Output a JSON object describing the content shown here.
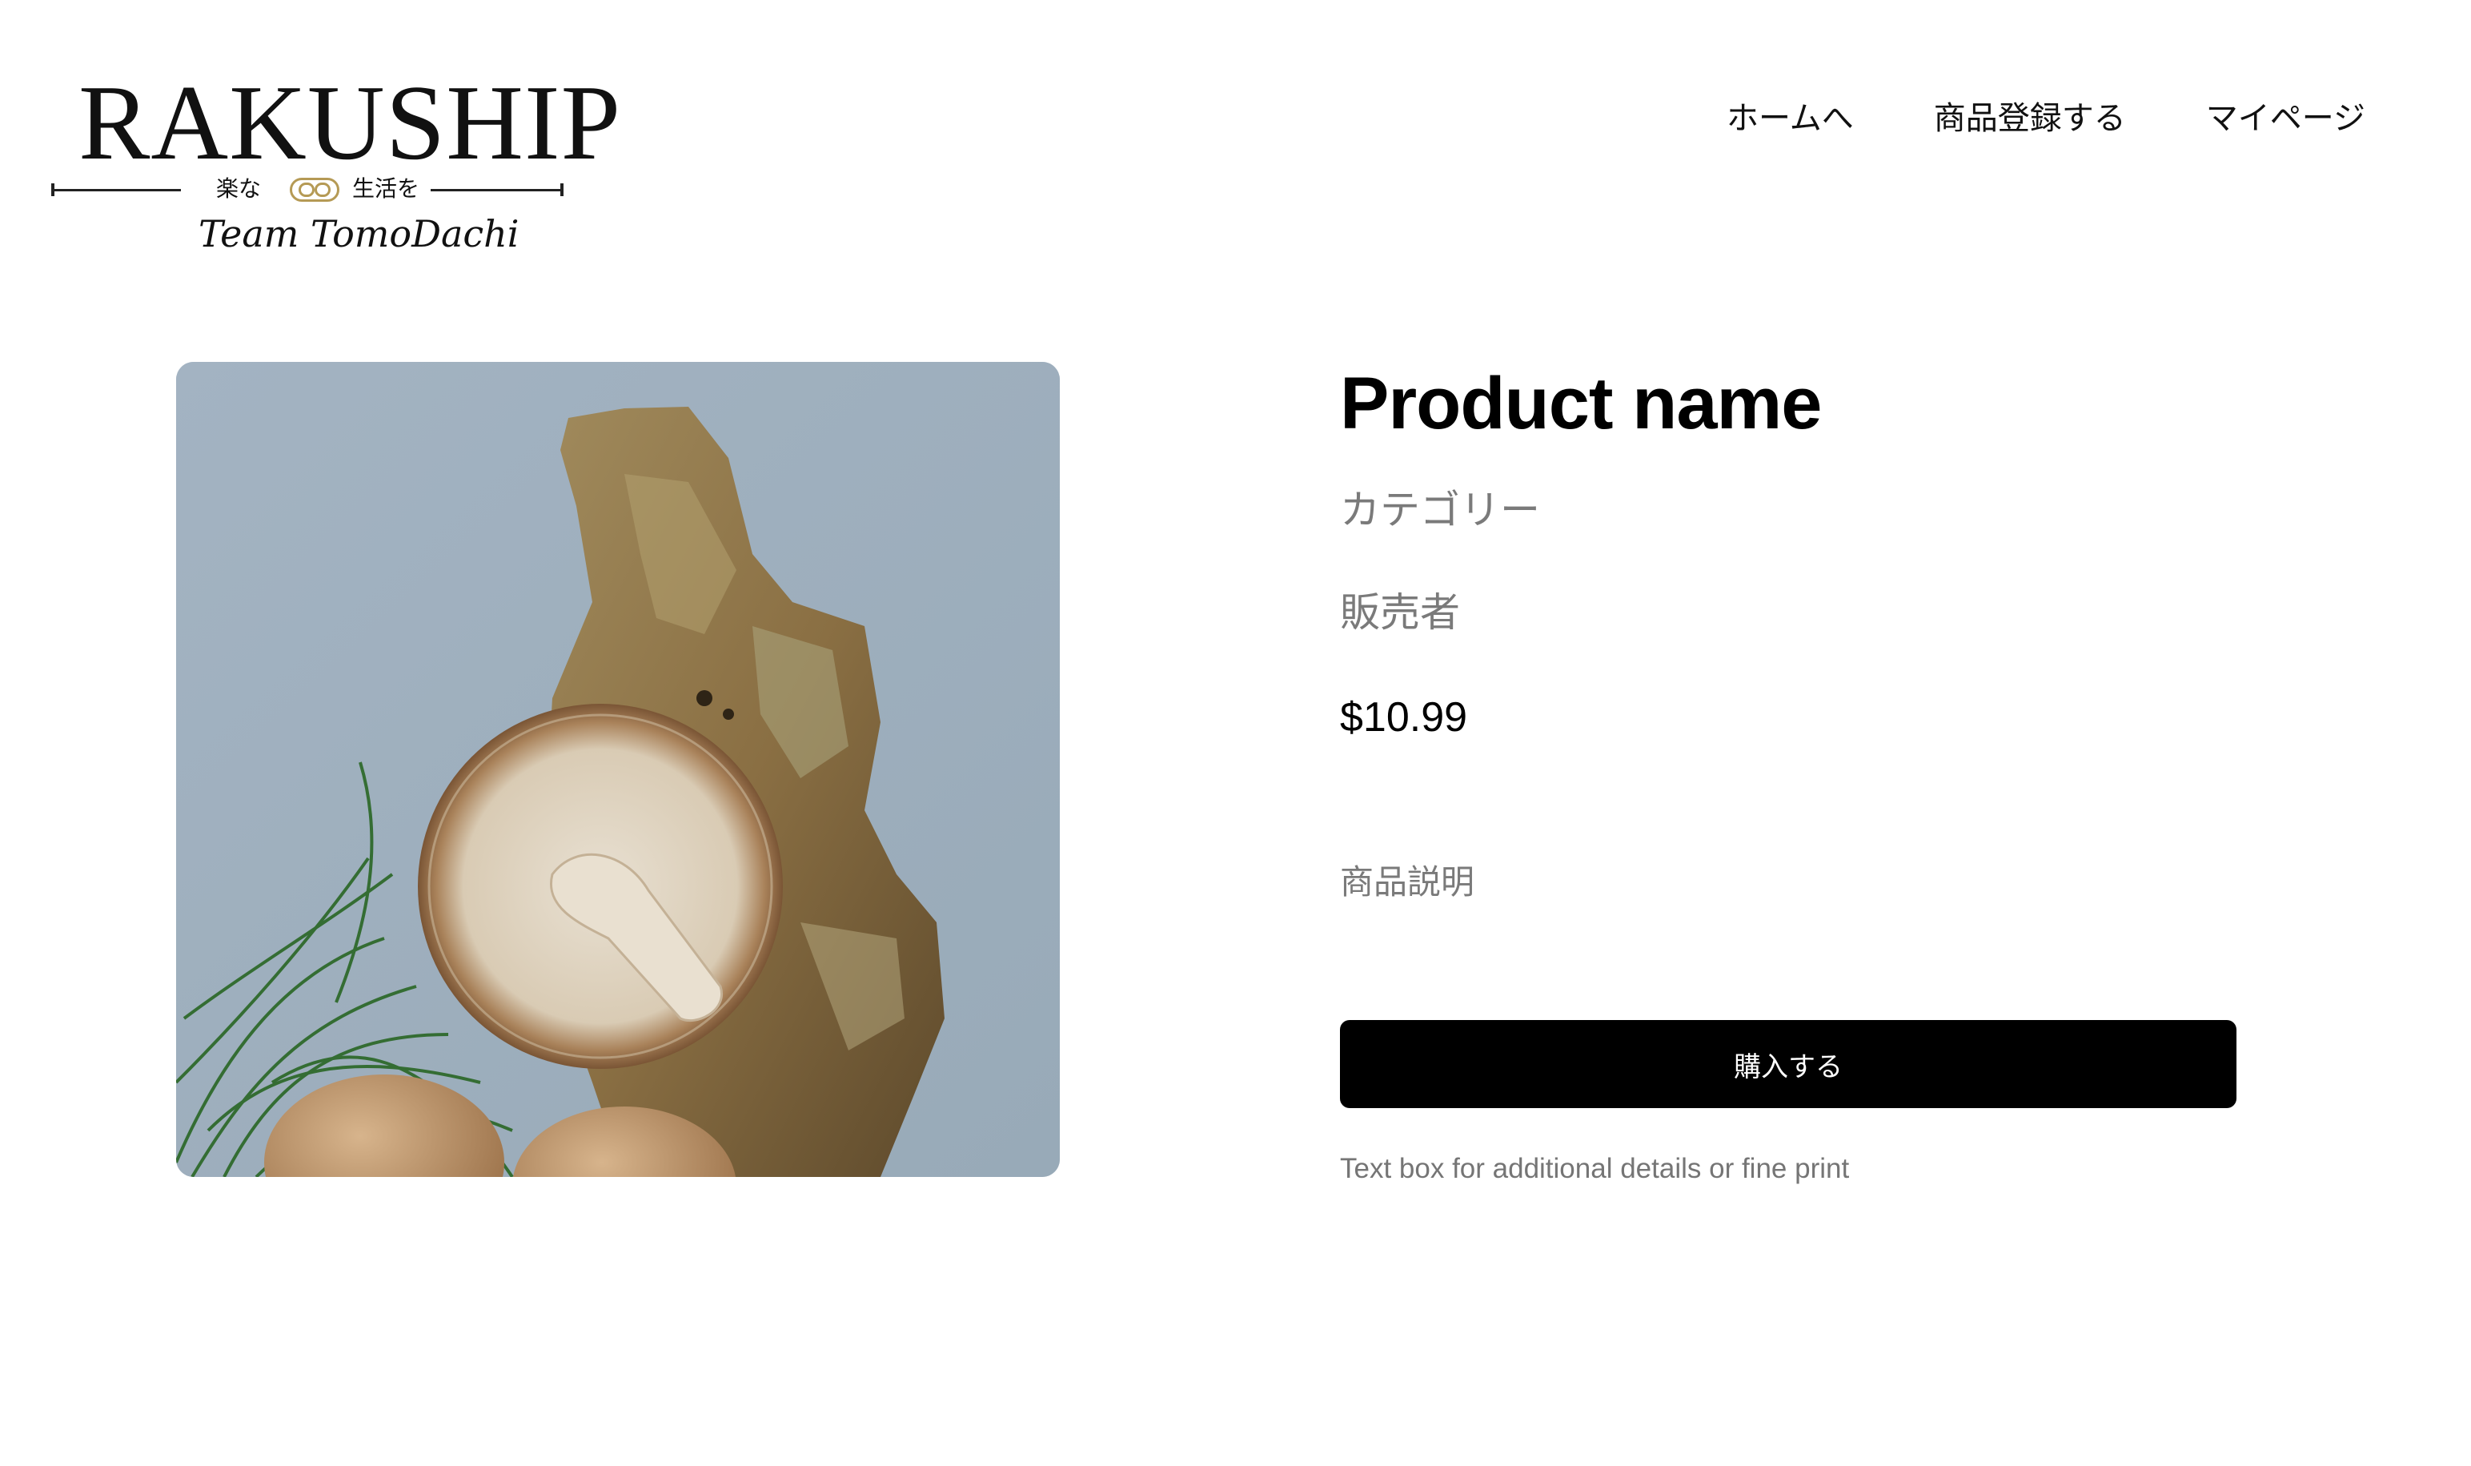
{
  "logo": {
    "wordmark": "RAKUSHIP",
    "tagline_left": "楽な",
    "tagline_right": "生活を",
    "team": "Team TomoDachi"
  },
  "nav": {
    "items": [
      {
        "label": "ホームへ"
      },
      {
        "label": "商品登録する"
      },
      {
        "label": "マイページ"
      }
    ]
  },
  "product": {
    "image_icon": "mushroom-photo",
    "title": "Product name",
    "category": "カテゴリー",
    "seller": "販売者",
    "price": "$10.99",
    "description": "商品説明",
    "buy_label": "購入する",
    "fine_print": "Text box for additional details or fine print"
  },
  "colors": {
    "background": "#ffffff",
    "text": "#000000",
    "muted_text": "#7a7a7a",
    "button_bg": "#000000",
    "button_text": "#ffffff",
    "logo_gold": "#b59a55",
    "photo_backdrop": "#a5b5c3"
  }
}
